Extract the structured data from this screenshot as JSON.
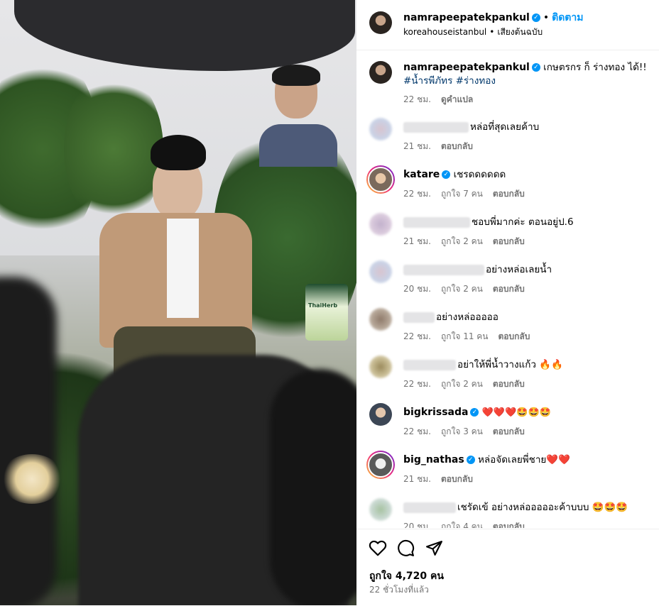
{
  "post": {
    "author": "namrapeepatekpankul",
    "follow_label": "ติดตาม",
    "location": "koreahouseistanbul",
    "audio": "เสียงต้นฉบับ",
    "photo_product_label": "ThaiHerb"
  },
  "caption": {
    "username": "namrapeepatekpankul",
    "text": "เกษตรกร ก็ ร่างทอง ได้!!",
    "hashtags": "#น้ำรพีภัทร #ร่างทอง",
    "time": "22 ชม.",
    "translate": "ดูคำแปล"
  },
  "comments": [
    {
      "username": "",
      "text": "หล่อที่สุดเลยค้าบ",
      "time": "21 ชม.",
      "likes": "",
      "reply": "ตอบกลับ"
    },
    {
      "username": "katare",
      "text": "เชรดดดดดด",
      "time": "22 ชม.",
      "likes": "ถูกใจ 7 คน",
      "reply": "ตอบกลับ"
    },
    {
      "username": "",
      "text": "ชอบพี่มากค่ะ ตอนอยู่ป.6",
      "time": "21 ชม.",
      "likes": "ถูกใจ 2 คน",
      "reply": "ตอบกลับ"
    },
    {
      "username": "",
      "text": "อย่างหล่อเลยน้ำ",
      "time": "20 ชม.",
      "likes": "ถูกใจ 2 คน",
      "reply": "ตอบกลับ"
    },
    {
      "username": "",
      "text": "อย่างหล่อออออ",
      "time": "22 ชม.",
      "likes": "ถูกใจ 11 คน",
      "reply": "ตอบกลับ"
    },
    {
      "username": "",
      "text": "อย่าให้พี่น้ำวางแก้ว 🔥🔥",
      "time": "22 ชม.",
      "likes": "ถูกใจ 2 คน",
      "reply": "ตอบกลับ"
    },
    {
      "username": "bigkrissada",
      "text": "❤️❤️❤️🤩🤩🤩",
      "time": "22 ชม.",
      "likes": "ถูกใจ 3 คน",
      "reply": "ตอบกลับ"
    },
    {
      "username": "big_nathas",
      "text": "หล่อจัดเลยพี่ชาย❤️❤️",
      "time": "21 ชม.",
      "likes": "",
      "reply": "ตอบกลับ"
    },
    {
      "username": "",
      "text": "เชรัดเข้ อย่างหล่อออออะค้าบบบ 🤩🤩🤩",
      "time": "20 ชม.",
      "likes": "ถูกใจ 4 คน",
      "reply": "ตอบกลับ"
    }
  ],
  "footer": {
    "likes": "ถูกใจ 4,720 คน",
    "posted": "22 ชั่วโมงที่แล้ว"
  },
  "icons": [
    "heart-icon",
    "comment-icon",
    "share-icon",
    "verified-badge-icon"
  ],
  "colors": {
    "accent": "#0095f6",
    "muted": "#737373",
    "hashtag": "#00376b"
  }
}
